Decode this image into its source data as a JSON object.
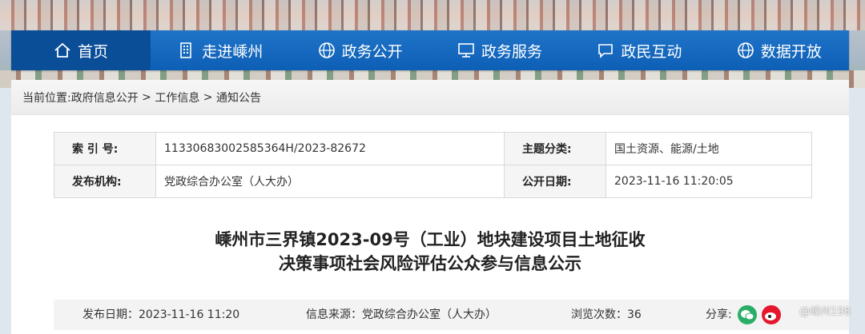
{
  "nav": {
    "items": [
      {
        "label": "首页",
        "icon": "home-icon"
      },
      {
        "label": "走进嵊州",
        "icon": "building-icon"
      },
      {
        "label": "政务公开",
        "icon": "globe-icon"
      },
      {
        "label": "政务服务",
        "icon": "monitor-icon"
      },
      {
        "label": "政民互动",
        "icon": "chat-icon"
      },
      {
        "label": "数据开放",
        "icon": "globe-icon"
      }
    ],
    "active_color": "#0a4e98",
    "bar_color": "#1f74c8"
  },
  "breadcrumb": {
    "prefix": "当前位置:",
    "items": [
      "政府信息公开",
      "工作信息",
      "通知公告"
    ],
    "separator": " > "
  },
  "meta": {
    "index_label": "索 引 号:",
    "index_value": "11330683002585364H/2023-82672",
    "category_label": "主题分类:",
    "category_value": "国土资源、能源/土地",
    "publisher_label": "发布机构:",
    "publisher_value": "党政综合办公室（人大办）",
    "open_date_label": "公开日期:",
    "open_date_value": "2023-11-16 11:20:05"
  },
  "article": {
    "title_line1": "嵊州市三界镇2023-09号（工业）地块建设项目土地征收",
    "title_line2": "决策事项社会风险评估公众参与信息公示"
  },
  "info": {
    "date_label": "发布日期：",
    "date_value": "2023-11-16 11:20",
    "source_label": "信息来源：",
    "source_value": "党政综合办公室（人大办）",
    "views_label": "浏览次数：",
    "views_value": "36",
    "share_label": "分享:"
  },
  "watermark": "@嵊州198"
}
